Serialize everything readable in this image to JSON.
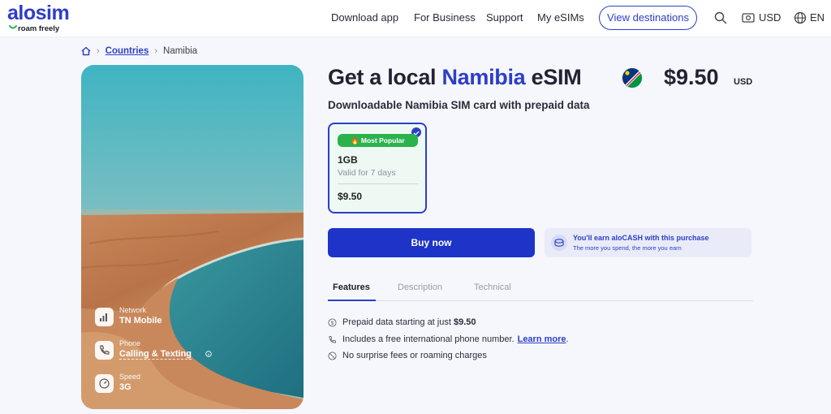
{
  "header": {
    "logo_text": "alosim",
    "logo_tagline": "roam freely",
    "nav": [
      "Download app",
      "For Business",
      "Support",
      "My eSIMs"
    ],
    "cta": "View destinations",
    "currency": "USD",
    "language": "EN",
    "icons": [
      "search-icon",
      "currency-icon",
      "globe-icon"
    ]
  },
  "breadcrumb": {
    "home_icon": "home-icon",
    "items": [
      "Countries",
      "Namibia"
    ]
  },
  "product": {
    "title_pre": "Get a local",
    "title_country": "Namibia",
    "title_post": "eSIM",
    "price": "$9.50",
    "currency": "USD",
    "subtitle": "Downloadable Namibia SIM card with prepaid data"
  },
  "plan": {
    "badge": "Most Popular",
    "badge_icon": "fire-icon",
    "data": "1GB",
    "validity": "Valid for 7 days",
    "price": "$9.50",
    "selected": true
  },
  "actions": {
    "buy": "Buy now",
    "alocash_title": "You'll earn aloCASH with this purchase",
    "alocash_sub": "The more you spend, the more you earn"
  },
  "specs": [
    {
      "icon": "signal-icon",
      "label": "Network",
      "value": "TN Mobile"
    },
    {
      "icon": "phone-icon",
      "label": "Phone",
      "value": "Calling & Texting"
    },
    {
      "icon": "speedometer-icon",
      "label": "Speed",
      "value": "3G"
    }
  ],
  "tabs": [
    "Features",
    "Description",
    "Technical"
  ],
  "active_tab": "Features",
  "features": [
    {
      "icon": "dollar-icon",
      "text": "Prepaid data starting at just",
      "bold": "$9.50",
      "link": "",
      "after": ""
    },
    {
      "icon": "phone-icon",
      "text": "Includes a free international phone number.",
      "bold": "",
      "link": "Learn more",
      "after": "."
    },
    {
      "icon": "no-fees-icon",
      "text": "No surprise fees or roaming charges",
      "bold": "",
      "link": "",
      "after": ""
    }
  ],
  "colors": {
    "brand": "#2d3ec7",
    "buy_button": "#1e33c7",
    "badge": "#2bb24c",
    "plan_bg": "#eef9f4",
    "page_bg": "#f5f7fd"
  }
}
